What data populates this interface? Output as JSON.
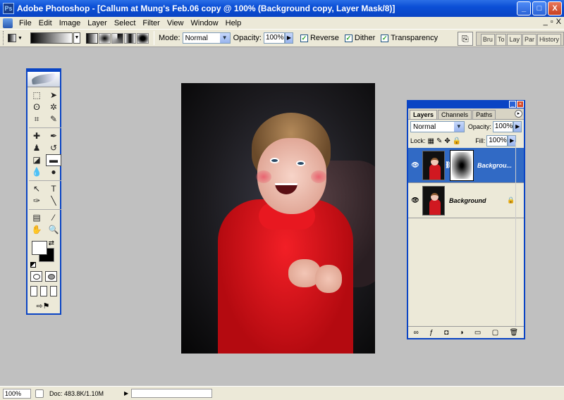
{
  "titlebar": {
    "app_icon": "Ps",
    "title": "Adobe Photoshop - [Callum at Mung's Feb.06 copy @ 100% (Background copy, Layer Mask/8)]",
    "minimize": "_",
    "maximize": "□",
    "close": "X"
  },
  "menu": {
    "items": [
      "File",
      "Edit",
      "Image",
      "Layer",
      "Select",
      "Filter",
      "View",
      "Window",
      "Help"
    ],
    "doc_controls": [
      "_",
      "▫",
      "X"
    ]
  },
  "options": {
    "mode_label": "Mode:",
    "mode_value": "Normal",
    "opacity_label": "Opacity:",
    "opacity_value": "100%",
    "reverse_label": "Reverse",
    "dither_label": "Dither",
    "transparency_label": "Transparency",
    "well_tabs": [
      "Bru",
      "To",
      "Lay",
      "Par",
      "History"
    ]
  },
  "layers_panel": {
    "tabs": [
      "Layers",
      "Channels",
      "Paths"
    ],
    "blend_mode": "Normal",
    "opacity_label": "Opacity:",
    "opacity_value": "100%",
    "lock_label": "Lock:",
    "fill_label": "Fill:",
    "fill_value": "100%",
    "layers": [
      {
        "name": "Backgrou...",
        "visible_icon": "👁"
      },
      {
        "name": "Background",
        "visible_icon": "👁",
        "lock": "🔒"
      }
    ],
    "footer_icons": [
      "∞",
      "ƒ",
      "◘",
      "◑",
      "▭",
      "▢",
      "🗑"
    ]
  },
  "status": {
    "zoom": "100%",
    "doc_info": "Doc: 483.8K/1.10M",
    "arrow": "▶"
  },
  "colors": {
    "accent": "#0a44c4",
    "chrome": "#ece9d8",
    "workspace": "#c0c0c0",
    "selected_layer": "#316ac5"
  }
}
